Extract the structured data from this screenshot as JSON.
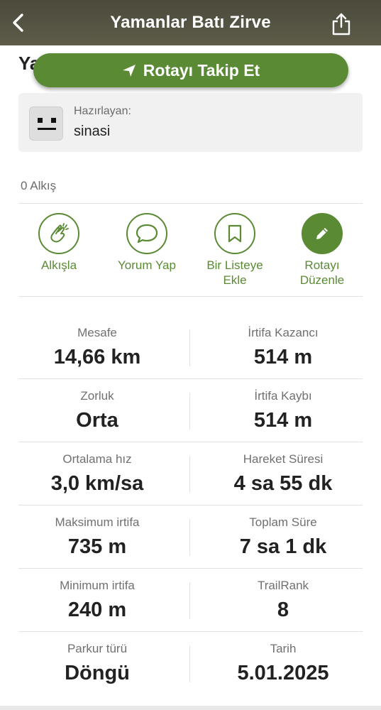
{
  "header": {
    "title": "Yamanlar Batı Zirve",
    "back_icon": "chevron-left-icon",
    "share_icon": "share-icon"
  },
  "behind_title": "Ya",
  "follow_button": {
    "label": "Rotayı Takip Et",
    "icon": "navigation-arrow-icon"
  },
  "author": {
    "label": "Hazırlayan:",
    "name": "sinasi"
  },
  "claps": "0 Alkış",
  "actions": [
    {
      "label": "Alkışla",
      "icon": "clap-icon"
    },
    {
      "label": "Yorum Yap",
      "icon": "comment-icon"
    },
    {
      "label": "Bir Listeye Ekle",
      "icon": "bookmark-icon"
    },
    {
      "label": "Rotayı Düzenle",
      "icon": "pencil-icon"
    }
  ],
  "stats": [
    {
      "left": {
        "label": "Mesafe",
        "value": "14,66 km"
      },
      "right": {
        "label": "İrtifa Kazancı",
        "value": "514 m"
      }
    },
    {
      "left": {
        "label": "Zorluk",
        "value": "Orta"
      },
      "right": {
        "label": "İrtifa Kaybı",
        "value": "514 m"
      }
    },
    {
      "left": {
        "label": "Ortalama hız",
        "value": "3,0 km/sa"
      },
      "right": {
        "label": "Hareket Süresi",
        "value": "4 sa 55 dk"
      }
    },
    {
      "left": {
        "label": "Maksimum irtifa",
        "value": "735 m"
      },
      "right": {
        "label": "Toplam Süre",
        "value": "7 sa 1 dk"
      }
    },
    {
      "left": {
        "label": "Minimum irtifa",
        "value": "240 m"
      },
      "right": {
        "label": "TrailRank",
        "value": "8"
      }
    },
    {
      "left": {
        "label": "Parkur türü",
        "value": "Döngü"
      },
      "right": {
        "label": "Tarih",
        "value": "5.01.2025"
      }
    }
  ],
  "colors": {
    "accent": "#5a8a34",
    "header_bg": "#4b4a3c"
  }
}
